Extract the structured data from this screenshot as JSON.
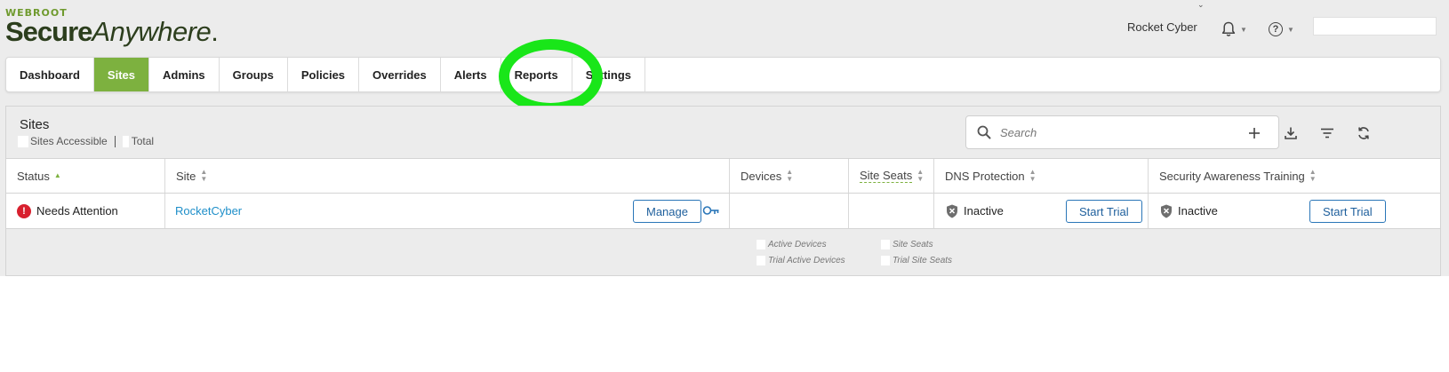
{
  "brand": {
    "top": "WEBROOT",
    "bold": "Secure",
    "light": "Anywhere",
    "tm": "."
  },
  "header": {
    "account_name": "Rocket Cyber"
  },
  "nav": {
    "tabs": [
      "Dashboard",
      "Sites",
      "Admins",
      "Groups",
      "Policies",
      "Overrides",
      "Alerts",
      "Reports",
      "Settings"
    ],
    "active": "Sites",
    "highlighted": "Settings"
  },
  "sites": {
    "title": "Sites",
    "accessible_label": "Sites Accessible",
    "total_label": "Total",
    "search_placeholder": "Search"
  },
  "table": {
    "columns": [
      "Status",
      "Site",
      "Devices",
      "Site Seats",
      "DNS Protection",
      "Security Awareness Training"
    ],
    "rows": [
      {
        "status": "Needs Attention",
        "site": "RocketCyber",
        "manage_label": "Manage",
        "dns_status": "Inactive",
        "dns_action": "Start Trial",
        "sat_status": "Inactive",
        "sat_action": "Start Trial"
      }
    ]
  },
  "footer_legend": {
    "active_devices": "Active Devices",
    "trial_active_devices": "Trial Active Devices",
    "site_seats": "Site Seats",
    "trial_site_seats": "Trial Site Seats"
  },
  "colors": {
    "accent_green": "#7db13f",
    "highlight": "#19e619",
    "link": "#1f8fc9",
    "alert_red": "#d8202e"
  },
  "icons": [
    "bell-icon",
    "help-icon",
    "search-icon",
    "plus-icon",
    "download-icon",
    "filter-icon",
    "refresh-icon",
    "key-icon",
    "shield-icon",
    "alert-icon"
  ]
}
